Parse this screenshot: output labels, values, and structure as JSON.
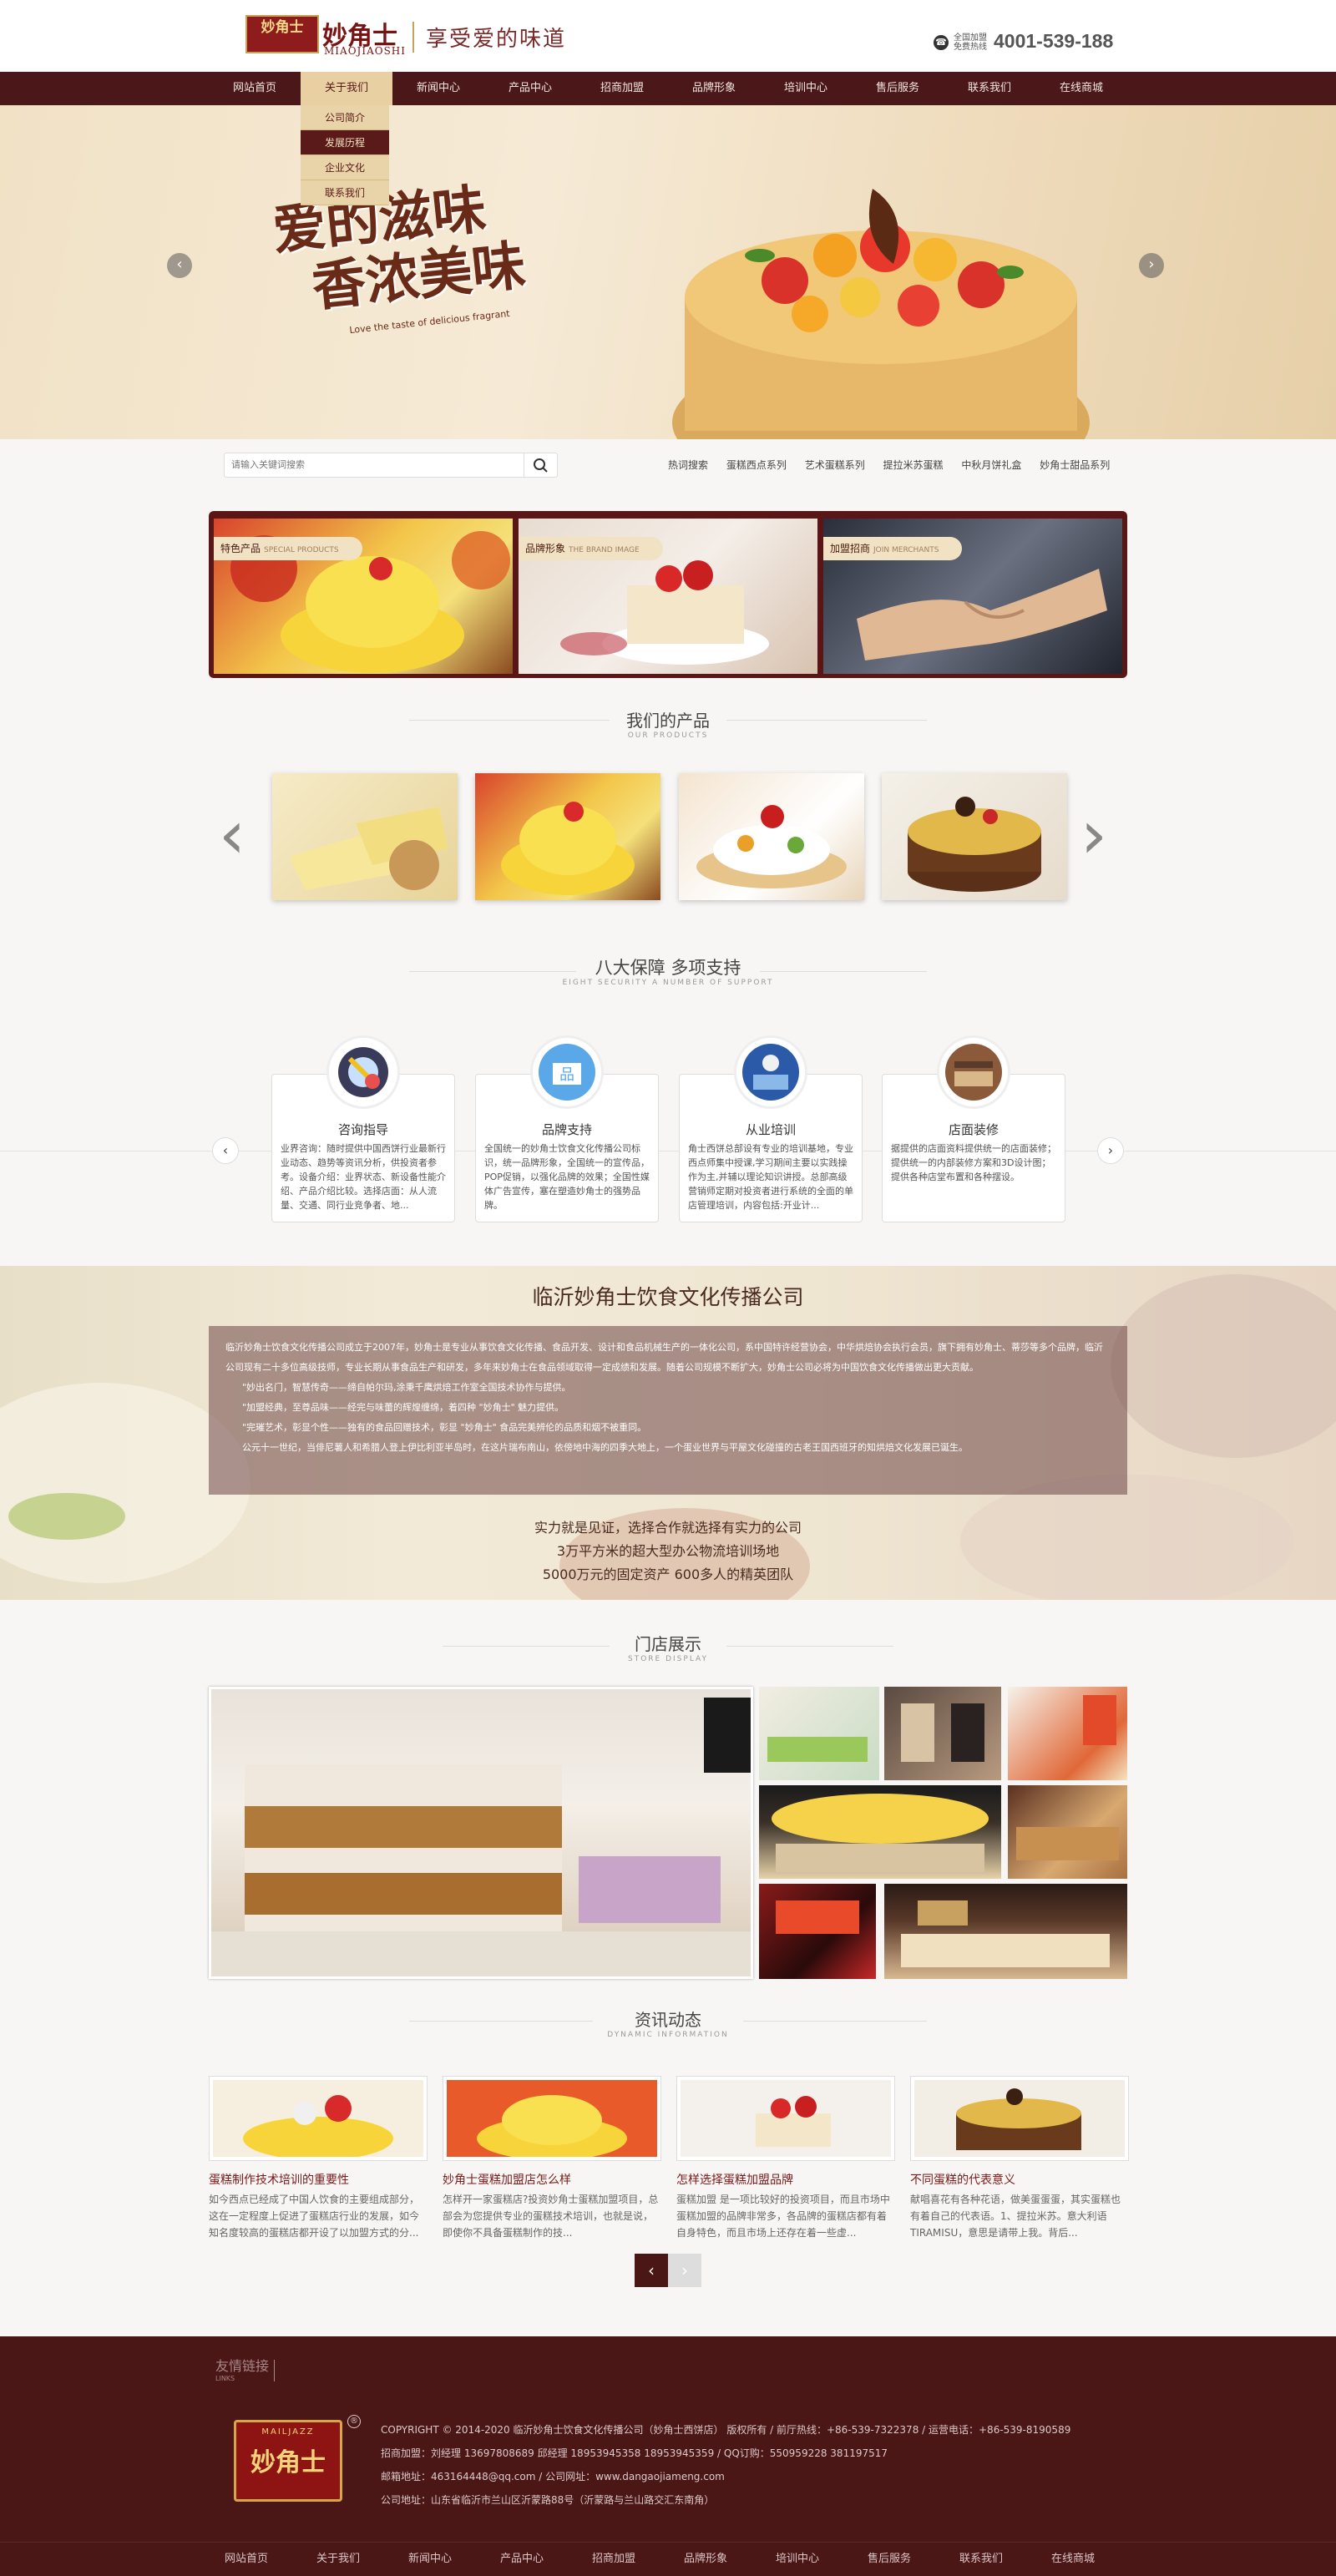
{
  "header": {
    "logo_top": "",
    "logo_cn": "妙角士",
    "logo_pinyin": "MIAOJIAOSHI",
    "slogan": "享受爱的味道",
    "phone_label": "全国加盟 免费热线",
    "phone_number": "4001-539-188"
  },
  "nav": {
    "items": [
      "网站首页",
      "关于我们",
      "新闻中心",
      "产品中心",
      "招商加盟",
      "品牌形象",
      "培训中心",
      "售后服务",
      "联系我们",
      "在线商城"
    ],
    "dropdown": [
      "公司简介",
      "发展历程",
      "企业文化",
      "联系我们"
    ]
  },
  "banner": {
    "slogan_line1": "爱的滋味",
    "slogan_line2": "香浓美味",
    "slogan_en": "Love the taste of delicious fragrant"
  },
  "search": {
    "placeholder": "请输入关键词搜索",
    "hot_links": [
      "热词搜索",
      "蛋糕西点系列",
      "艺术蛋糕系列",
      "提拉米苏蛋糕",
      "中秋月饼礼盒",
      "妙角士甜品系列"
    ]
  },
  "features": [
    {
      "title": "特色产品",
      "sub": "SPECIAL PRODUCTS"
    },
    {
      "title": "品牌形象",
      "sub": "THE BRAND IMAGE"
    },
    {
      "title": "加盟招商",
      "sub": "JOIN MERCHANTS"
    }
  ],
  "products": {
    "title": "我们的产品",
    "subtitle": "OUR PRODUCTS"
  },
  "support": {
    "title": "八大保障 多项支持",
    "subtitle": "EIGHT SECURITY A NUMBER OF SUPPORT",
    "cards": [
      {
        "title": "咨询指导",
        "text": "业界咨询：随时提供中国西饼行业最新行业动态、趋势等资讯分析，供投资者参考。设备介绍：业界状态、新设备性能介绍、产品介绍比较。选择店面：从人流量、交通、同行业竞争者、地..."
      },
      {
        "title": "品牌支持",
        "text": "全国统一的妙角士饮食文化传播公司标识，统一品牌形象，全国统一的宣传品，POP促销，以强化品牌的效果；全国性媒体广告宣传，塞在塑造妙角士的强势品牌。"
      },
      {
        "title": "从业培训",
        "text": "角士西饼总部设有专业的培训基地，专业西点师集中授课,学习期间主要以实践操作为主,并辅以理论知识讲授。总部高级营销师定期对投资者进行系统的全面的单店管理培训，内容包括:开业计..."
      },
      {
        "title": "店面装修",
        "text": "据提供的店面资料提供统一的店面装修；提供统一的内部装修方案和3D设计图；提供各种店堂布置和各种摆设。"
      }
    ]
  },
  "company": {
    "title": "临沂妙角士饮食文化传播公司",
    "para1": "临沂妙角士饮食文化传播公司成立于2007年，妙角士是专业从事饮食文化传播、食品开发、设计和食品机械生产的一体化公司，系中国特许经营协会，中华烘焙协会执行会员，旗下拥有妙角士、蒂莎等多个品牌，临沂公司现有二十多位高级技师，专业长期从事食品生产和研发，多年来妙角士在食品领域取得一定成绩和发展。随着公司规模不断扩大，妙角士公司必将为中国饮食文化传播做出更大贡献。",
    "para2": "\"妙出名门，智慧传奇——缔自帕尔玛,涂秉千鹰烘焙工作室全国技术协作与提供。",
    "para3": "\"加盟经典，至尊品味——经完与味蕾的辉煌缠绵，着四种 \"妙角士\" 魅力提供。",
    "para4": "\"完璀艺术，彰显个性——独有的食品回赠技术，彰显 \"妙角士\" 食品完美辨伦的品质和烟不被重同。",
    "para5": "公元十一世纪，当俳尼薯人和希腊人登上伊比利亚半岛时，在这片瑞布南山，依傍地中海的四季大地上，一个蛋业世界与平屋文化碰撞的古老王国西班牙的知烘焙文化发展已诞生。",
    "tag1": "实力就是见证，选择合作就选择有实力的公司",
    "tag2": "3万平方米的超大型办公物流培训场地",
    "tag3": "5000万元的固定资产    600多人的精英团队"
  },
  "stores": {
    "title": "门店展示",
    "subtitle": "STORE DISPLAY"
  },
  "news": {
    "title": "资讯动态",
    "subtitle": "DYNAMIC INFORMATION",
    "items": [
      {
        "title": "蛋糕制作技术培训的重要性",
        "text": "如今西点已经成了中国人饮食的主要组成部分，这在一定程度上促进了蛋糕店行业的发展，如今知名度较高的蛋糕店都开设了以加盟方式的分..."
      },
      {
        "title": "妙角士蛋糕加盟店怎么样",
        "text": "怎样开一家蛋糕店?投资妙角士蛋糕加盟项目，总部会为您提供专业的蛋糕技术培训，也就是说，即使你不具备蛋糕制作的技..."
      },
      {
        "title": "怎样选择蛋糕加盟品牌",
        "text": "蛋糕加盟 是一项比较好的投资项目，而且市场中蛋糕加盟的品牌非常多，各品牌的蛋糕店都有着自身特色，而且市场上还存在着一些虚..."
      },
      {
        "title": "不同蛋糕的代表意义",
        "text": "献唱喜花有各种花语，做美蛋蛋蛋，其实蛋糕也有着自己的代表语。1、提拉米苏。意大利语TIRAMISU，意思是请带上我。背后..."
      }
    ]
  },
  "footer": {
    "friend_title": "友情链接",
    "friend_sub": "LINKS",
    "logo_pinyin": "MAILJAZZ",
    "logo_cn": "妙角士",
    "lines": [
      "COPYRIGHT  ©  2014-2020  临沂妙角士饮食文化传播公司（妙角士西饼店）  版权所有   /   前厅热线：+86-539-7322378   /   运营电话：+86-539-8190589",
      "招商加盟：刘经理  13697808689  邱经理  18953945358  18953945359   /   QQ订购：550959228   381197517",
      "邮箱地址：463164448@qq.com   /   公司网址：www.dangaojiameng.com",
      "公司地址：山东省临沂市兰山区沂蒙路88号（沂蒙路与兰山路交汇东南角）"
    ],
    "nav": [
      "网站首页",
      "关于我们",
      "新闻中心",
      "产品中心",
      "招商加盟",
      "品牌形象",
      "培训中心",
      "售后服务",
      "联系我们",
      "在线商城"
    ]
  }
}
